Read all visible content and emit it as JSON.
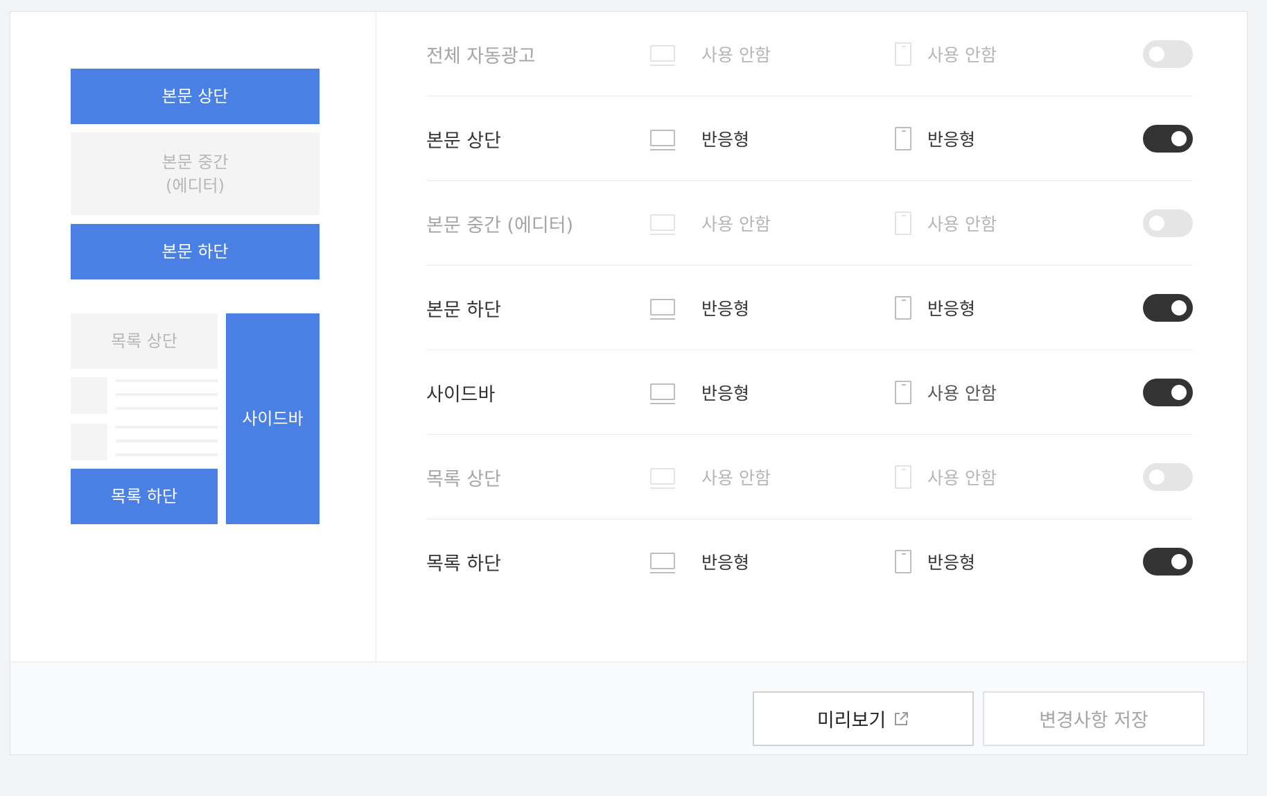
{
  "preview": {
    "body_top": "본문 상단",
    "body_middle_line1": "본문 중간",
    "body_middle_line2": "(에디터)",
    "body_bottom": "본문 하단",
    "list_top": "목록 상단",
    "sidebar": "사이드바",
    "list_bottom": "목록 하단"
  },
  "rows": [
    {
      "name": "전체 자동광고",
      "pc": "사용 안함",
      "mobile": "사용 안함",
      "enabled": false
    },
    {
      "name": "본문 상단",
      "pc": "반응형",
      "mobile": "반응형",
      "enabled": true
    },
    {
      "name": "본문 중간 (에디터)",
      "pc": "사용 안함",
      "mobile": "사용 안함",
      "enabled": false
    },
    {
      "name": "본문 하단",
      "pc": "반응형",
      "mobile": "반응형",
      "enabled": true
    },
    {
      "name": "사이드바",
      "pc": "반응형",
      "mobile": "사용 안함",
      "enabled": true
    },
    {
      "name": "목록 상단",
      "pc": "사용 안함",
      "mobile": "사용 안함",
      "enabled": false
    },
    {
      "name": "목록 하단",
      "pc": "반응형",
      "mobile": "반응형",
      "enabled": true
    }
  ],
  "buttons": {
    "preview": "미리보기",
    "save": "변경사항 저장"
  },
  "colors": {
    "active_block": "#4a80e3",
    "toggle_on": "#333333",
    "toggle_off": "#e5e5e5"
  },
  "icons": {
    "pc": "monitor-icon",
    "mobile": "mobile-icon",
    "preview": "external-link-icon"
  }
}
